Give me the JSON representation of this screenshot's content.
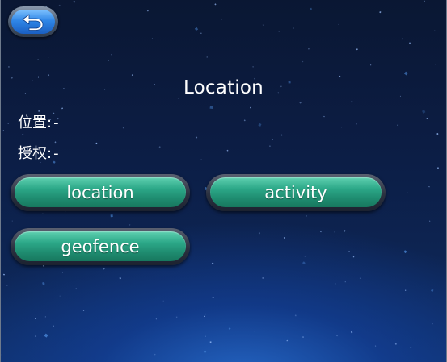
{
  "header": {
    "back_icon": "back-arrow-icon"
  },
  "page": {
    "title": "Location"
  },
  "info": {
    "location_label": "位置:",
    "location_value": "-",
    "auth_label": "授权:",
    "auth_value": "-"
  },
  "buttons": {
    "location": "location",
    "activity": "activity",
    "geofence": "geofence"
  },
  "colors": {
    "button_green": "#2ca888",
    "back_blue": "#2f86e6",
    "background": "#0c1d44"
  }
}
